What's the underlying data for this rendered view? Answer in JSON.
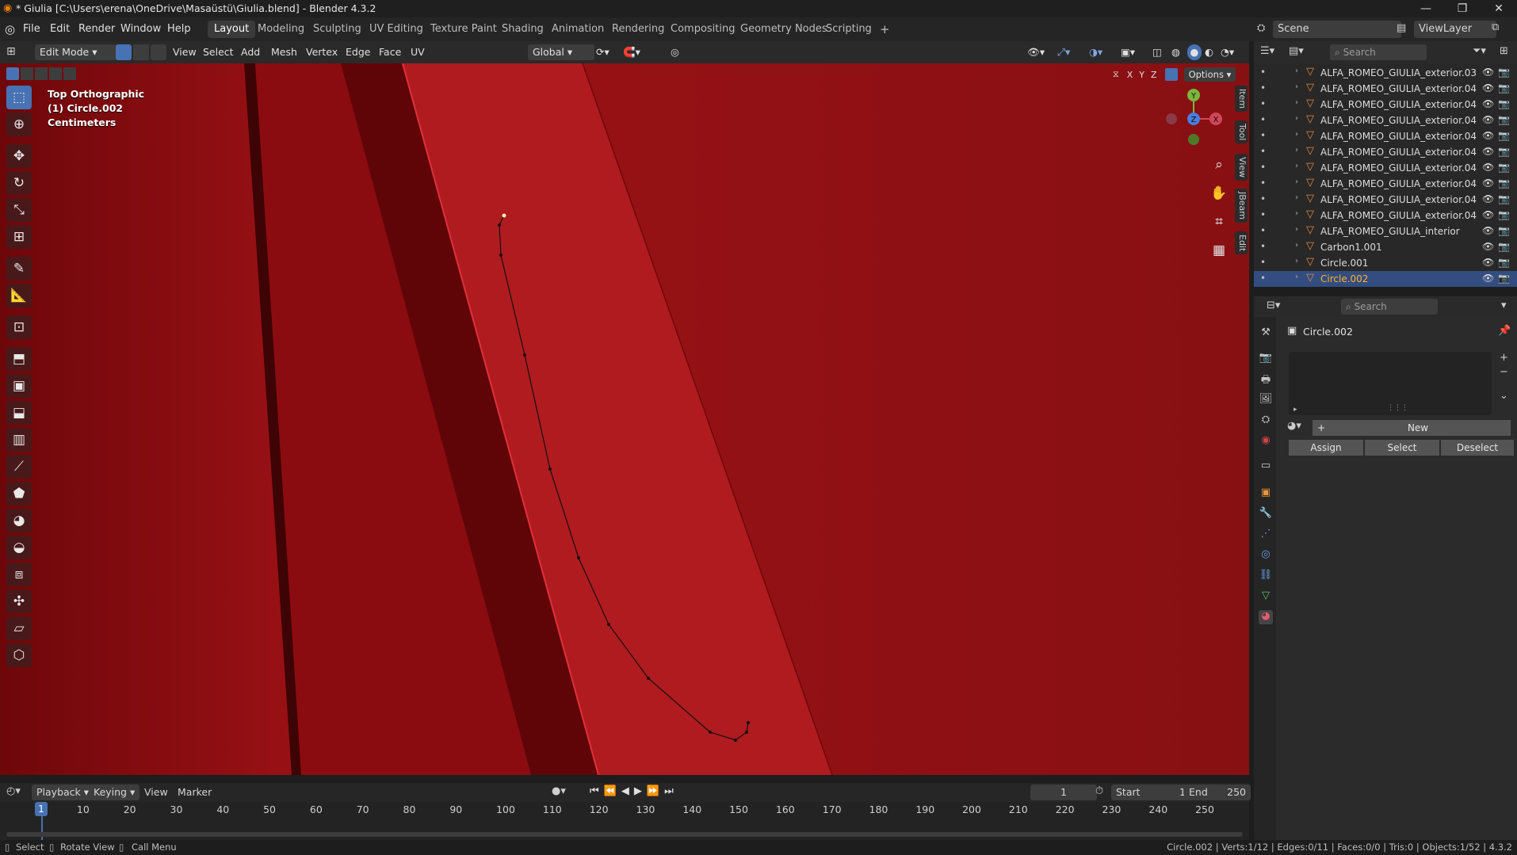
{
  "window": {
    "title": "* Giulia [C:\\Users\\erena\\OneDrive\\Masaüstü\\Giulia.blend] - Blender 4.3.2",
    "minimize": "—",
    "maximize": "❐",
    "close": "✕"
  },
  "menu": [
    "File",
    "Edit",
    "Render",
    "Window",
    "Help"
  ],
  "workspaces": [
    "Layout",
    "Modeling",
    "Sculpting",
    "UV Editing",
    "Texture Paint",
    "Shading",
    "Animation",
    "Rendering",
    "Compositing",
    "Geometry Nodes",
    "Scripting"
  ],
  "workspaces_add": "+",
  "scene": {
    "label": "Scene",
    "viewlayer": "ViewLayer"
  },
  "viewport_header": {
    "mode": "Edit Mode",
    "menus": [
      "View",
      "Select",
      "Add",
      "Mesh",
      "Vertex",
      "Edge",
      "Face",
      "UV"
    ],
    "orientation": "Global",
    "options": "Options",
    "axes": [
      "X",
      "Y",
      "Z"
    ]
  },
  "viewport": {
    "view_name": "Top Orthographic",
    "object_name": "(1) Circle.002",
    "units": "Centimeters",
    "gizmo": {
      "y": "Y",
      "x": "X",
      "z": "Z"
    },
    "side_tabs": [
      "Item",
      "Tool",
      "View",
      "JBeam",
      "Edit"
    ],
    "colors": {
      "background": "#8e0d10",
      "accent": "#4772b3"
    }
  },
  "outliner": {
    "search_placeholder": "Search",
    "items": [
      {
        "name": "ALFA_ROMEO_GIULIA_exterior.03",
        "selected": false
      },
      {
        "name": "ALFA_ROMEO_GIULIA_exterior.04",
        "selected": false
      },
      {
        "name": "ALFA_ROMEO_GIULIA_exterior.04",
        "selected": false
      },
      {
        "name": "ALFA_ROMEO_GIULIA_exterior.04",
        "selected": false
      },
      {
        "name": "ALFA_ROMEO_GIULIA_exterior.04",
        "selected": false
      },
      {
        "name": "ALFA_ROMEO_GIULIA_exterior.04",
        "selected": false
      },
      {
        "name": "ALFA_ROMEO_GIULIA_exterior.04",
        "selected": false
      },
      {
        "name": "ALFA_ROMEO_GIULIA_exterior.04",
        "selected": false
      },
      {
        "name": "ALFA_ROMEO_GIULIA_exterior.04",
        "selected": false
      },
      {
        "name": "ALFA_ROMEO_GIULIA_exterior.04",
        "selected": false
      },
      {
        "name": "ALFA_ROMEO_GIULIA_interior",
        "selected": false
      },
      {
        "name": "Carbon1.001",
        "selected": false
      },
      {
        "name": "Circle.001",
        "selected": false
      },
      {
        "name": "Circle.002",
        "selected": true
      }
    ]
  },
  "properties": {
    "search_placeholder": "Search",
    "object_name": "Circle.002",
    "new_label": "New",
    "assign_label": "Assign",
    "select_label": "Select",
    "deselect_label": "Deselect"
  },
  "timeline": {
    "menus": [
      "Playback",
      "Keying",
      "View",
      "Marker"
    ],
    "current_frame": "1",
    "start_label": "Start",
    "start": "1",
    "end_label": "End",
    "end": "250",
    "ticks": [
      "10",
      "20",
      "30",
      "40",
      "50",
      "60",
      "70",
      "80",
      "90",
      "100",
      "110",
      "120",
      "130",
      "140",
      "150",
      "160",
      "170",
      "180",
      "190",
      "200",
      "210",
      "220",
      "230",
      "240",
      "250"
    ],
    "playhead": "1"
  },
  "statusbar": {
    "select": "Select",
    "rotate": "Rotate View",
    "call_menu": "Call Menu",
    "stats": "Circle.002 | Verts:1/12 | Edges:0/11 | Faces:0/0 | Tris:0 | Objects:1/52 | 4.3.2"
  }
}
